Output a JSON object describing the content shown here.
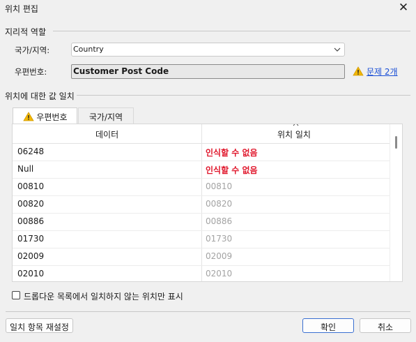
{
  "window": {
    "title": "위치 편집",
    "close_label": "✕"
  },
  "geo_role": {
    "section_title": "지리적 역할",
    "country_label": "국가/지역:",
    "country_value": "Country",
    "postcode_label": "우편번호:",
    "postcode_value": "Customer Post Code",
    "issues_link": "문제 2개"
  },
  "match_section": {
    "title": "위치에 대한 값 일치",
    "tabs": [
      {
        "label": "우편번호",
        "warning": true
      },
      {
        "label": "국가/지역",
        "warning": false
      }
    ],
    "columns": [
      "데이터",
      "위치 일치"
    ],
    "rows": [
      {
        "data": "06248",
        "match": "인식할 수 없음",
        "unrecognized": true
      },
      {
        "data": "Null",
        "match": "인식할 수 없음",
        "unrecognized": true
      },
      {
        "data": "00810",
        "match": "00810",
        "unrecognized": false
      },
      {
        "data": "00820",
        "match": "00820",
        "unrecognized": false
      },
      {
        "data": "00886",
        "match": "00886",
        "unrecognized": false
      },
      {
        "data": "01730",
        "match": "01730",
        "unrecognized": false
      },
      {
        "data": "02009",
        "match": "02009",
        "unrecognized": false
      },
      {
        "data": "02010",
        "match": "02010",
        "unrecognized": false
      }
    ]
  },
  "filter_checkbox_label": "드롭다운 목록에서 일치하지 않는 위치만 표시",
  "buttons": {
    "reset": "일치 항목 재설정",
    "ok": "확인",
    "cancel": "취소"
  },
  "colors": {
    "error": "#e0162b",
    "link": "#1a4fd6",
    "warning": "#f2b705"
  },
  "icons": {
    "warning": "warning-icon",
    "close": "close-icon",
    "dropdown": "chevron-down-icon",
    "sort": "sort-up-icon"
  }
}
